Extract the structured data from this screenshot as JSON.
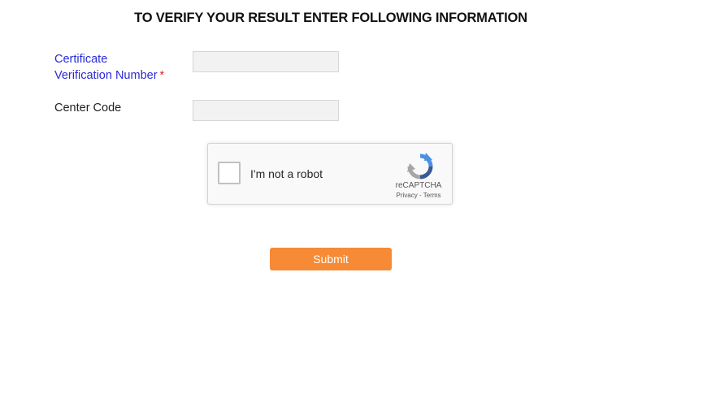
{
  "heading": "TO VERIFY YOUR RESULT ENTER FOLLOWING INFORMATION",
  "fields": [
    {
      "label_line1": "Certificate",
      "label_line2": "Verification Number",
      "required_marker": "*",
      "value": "",
      "placeholder": ""
    },
    {
      "label": "Center Code",
      "value": "",
      "placeholder": ""
    }
  ],
  "recaptcha": {
    "label": "I'm not a robot",
    "brand": "reCAPTCHA",
    "privacy": "Privacy",
    "separator": " - ",
    "terms": "Terms",
    "checked": false,
    "logo_icon": "recaptcha-logo-icon"
  },
  "submit_label": "Submit",
  "colors": {
    "label_blue": "#2a2ad8",
    "required_red": "#e02222",
    "submit_orange": "#f78a35",
    "input_bg": "#f2f2f2"
  }
}
